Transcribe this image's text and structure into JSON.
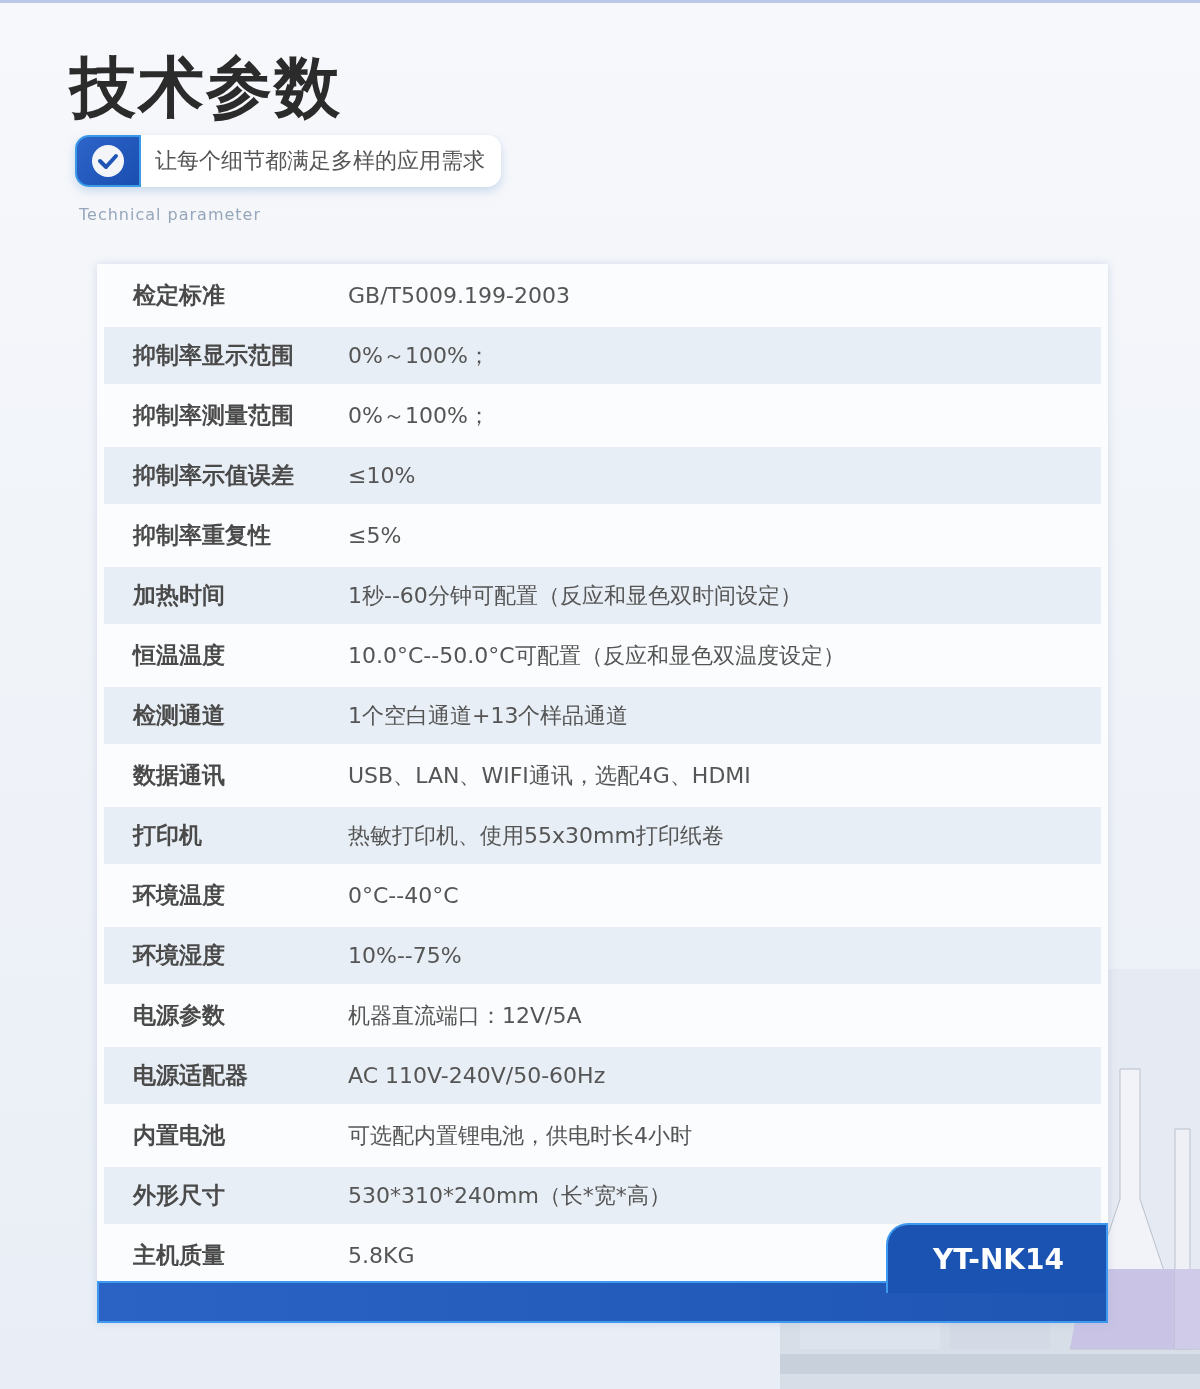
{
  "header": {
    "title": "技术参数",
    "badge": "让每个细节都满足多样的应用需求",
    "subtitle": "Technical parameter"
  },
  "specs": [
    {
      "label": "检定标准",
      "value": "GB/T5009.199-2003"
    },
    {
      "label": "抑制率显示范围",
      "value": "0%～100%；"
    },
    {
      "label": "抑制率测量范围",
      "value": "0%～100%；"
    },
    {
      "label": "抑制率示值误差",
      "value": "≤10%"
    },
    {
      "label": "抑制率重复性",
      "value": "≤5%"
    },
    {
      "label": "加热时间",
      "value": "1秒--60分钟可配置（反应和显色双时间设定）"
    },
    {
      "label": "恒温温度",
      "value": "10.0°C--50.0°C可配置（反应和显色双温度设定）"
    },
    {
      "label": "检测通道",
      "value": "1个空白通道+13个样品通道"
    },
    {
      "label": "数据通讯",
      "value": "USB、LAN、WIFI通讯，选配4G、HDMI"
    },
    {
      "label": "打印机",
      "value": "热敏打印机、使用55x30mm打印纸卷"
    },
    {
      "label": "环境温度",
      "value": "0°C--40°C"
    },
    {
      "label": "环境湿度",
      "value": "10%--75%"
    },
    {
      "label": "电源参数",
      "value": "机器直流端口：12V/5A"
    },
    {
      "label": "电源适配器",
      "value": "AC 110V-240V/50-60Hz"
    },
    {
      "label": "内置电池",
      "value": "可选配内置锂电池，供电时长4小时"
    },
    {
      "label": "外形尺寸",
      "value": "530*310*240mm（长*宽*高）"
    },
    {
      "label": "主机质量",
      "value": "5.8KG"
    }
  ],
  "model": "YT-NK14"
}
